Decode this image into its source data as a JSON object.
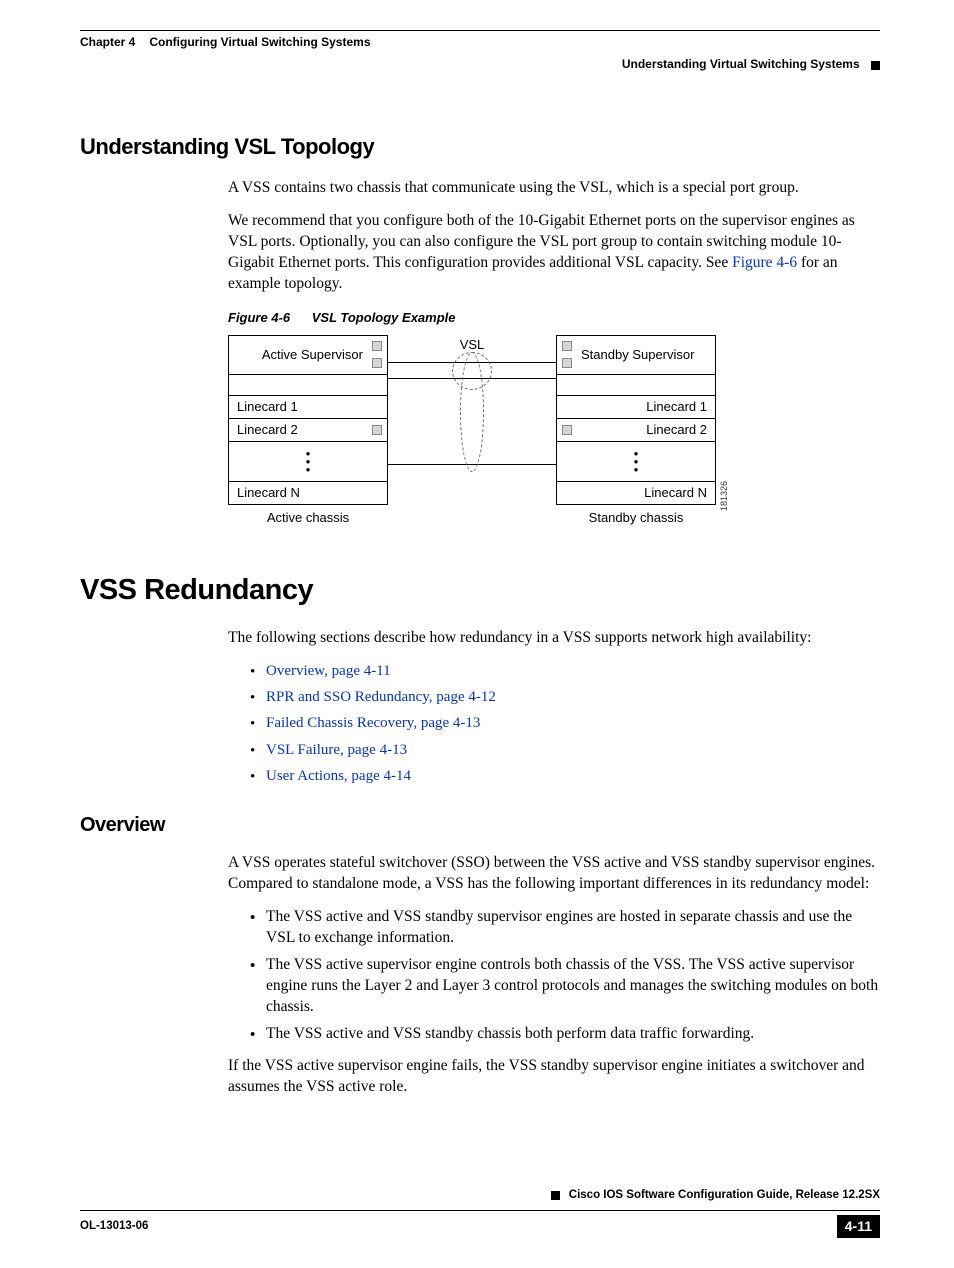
{
  "header": {
    "chapter": "Chapter 4",
    "chapter_title": "Configuring Virtual Switching Systems",
    "section": "Understanding Virtual Switching Systems"
  },
  "section1": {
    "heading": "Understanding VSL Topology",
    "p1": "A VSS contains two chassis that communicate using the VSL, which is a special port group.",
    "p2a": "We recommend that you configure both of the 10-Gigabit Ethernet ports on the supervisor engines as VSL ports. Optionally, you can also configure the VSL port group to contain switching module 10-Gigabit Ethernet ports. This configuration provides additional VSL capacity. See ",
    "p2_link": "Figure 4-6",
    "p2b": " for an example topology.",
    "figure_num": "Figure 4-6",
    "figure_title": "VSL Topology Example"
  },
  "diagram": {
    "vsl": "VSL",
    "active_sup": "Active Supervisor",
    "standby_sup": "Standby Supervisor",
    "lc1": "Linecard 1",
    "lc2": "Linecard 2",
    "lcn": "Linecard N",
    "active_chassis": "Active chassis",
    "standby_chassis": "Standby chassis",
    "img_id": "181326"
  },
  "section2": {
    "heading": "VSS Redundancy",
    "intro": "The following sections describe how redundancy in a VSS supports network high availability:",
    "links": [
      "Overview, page 4-11",
      "RPR and SSO Redundancy, page 4-12",
      "Failed Chassis Recovery, page 4-13",
      "VSL Failure, page 4-13",
      "User Actions, page 4-14"
    ]
  },
  "section3": {
    "heading": "Overview",
    "p1": "A VSS operates stateful switchover (SSO) between the VSS active and VSS standby supervisor engines. Compared to standalone mode, a VSS has the following important differences in its redundancy model:",
    "bullets": [
      "The VSS active and VSS standby supervisor engines are hosted in separate chassis and use the VSL to exchange information.",
      "The VSS active supervisor engine controls both chassis of the VSS. The VSS active supervisor engine runs the Layer 2 and Layer 3 control protocols and manages the switching modules on both chassis.",
      "The VSS active and VSS standby chassis both perform data traffic forwarding."
    ],
    "p2": "If the VSS active supervisor engine fails, the VSS standby supervisor engine initiates a switchover and assumes the VSS active role."
  },
  "footer": {
    "guide": "Cisco IOS Software Configuration Guide, Release 12.2SX",
    "doc": "OL-13013-06",
    "page": "4-11"
  }
}
